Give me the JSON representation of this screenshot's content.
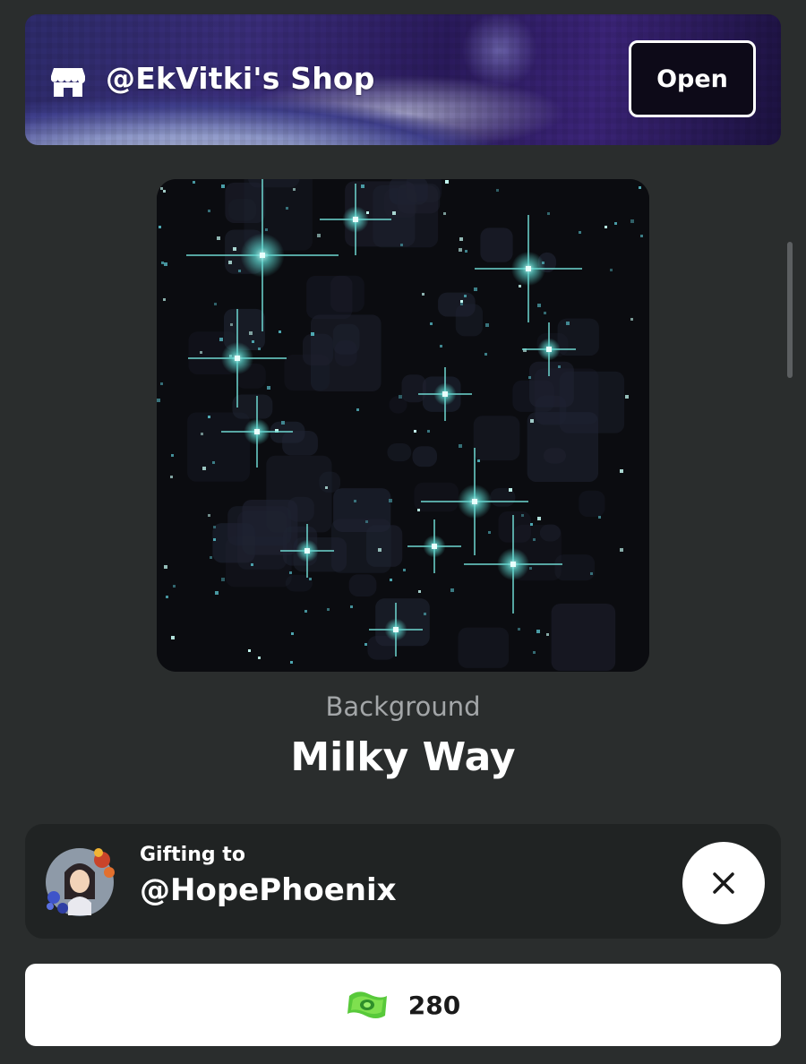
{
  "shop": {
    "name": "@EkVitki's Shop",
    "open_label": "Open"
  },
  "item": {
    "type": "Background",
    "name": "Milky Way"
  },
  "gift": {
    "label": "Gifting to",
    "recipient": "@HopePhoenix"
  },
  "purchase": {
    "price": "280",
    "currency_icon": "cash-icon"
  },
  "colors": {
    "background": "#2a2d2d",
    "card": "#202323",
    "star": "#7fe6e0",
    "currency_green": "#58c93a"
  }
}
